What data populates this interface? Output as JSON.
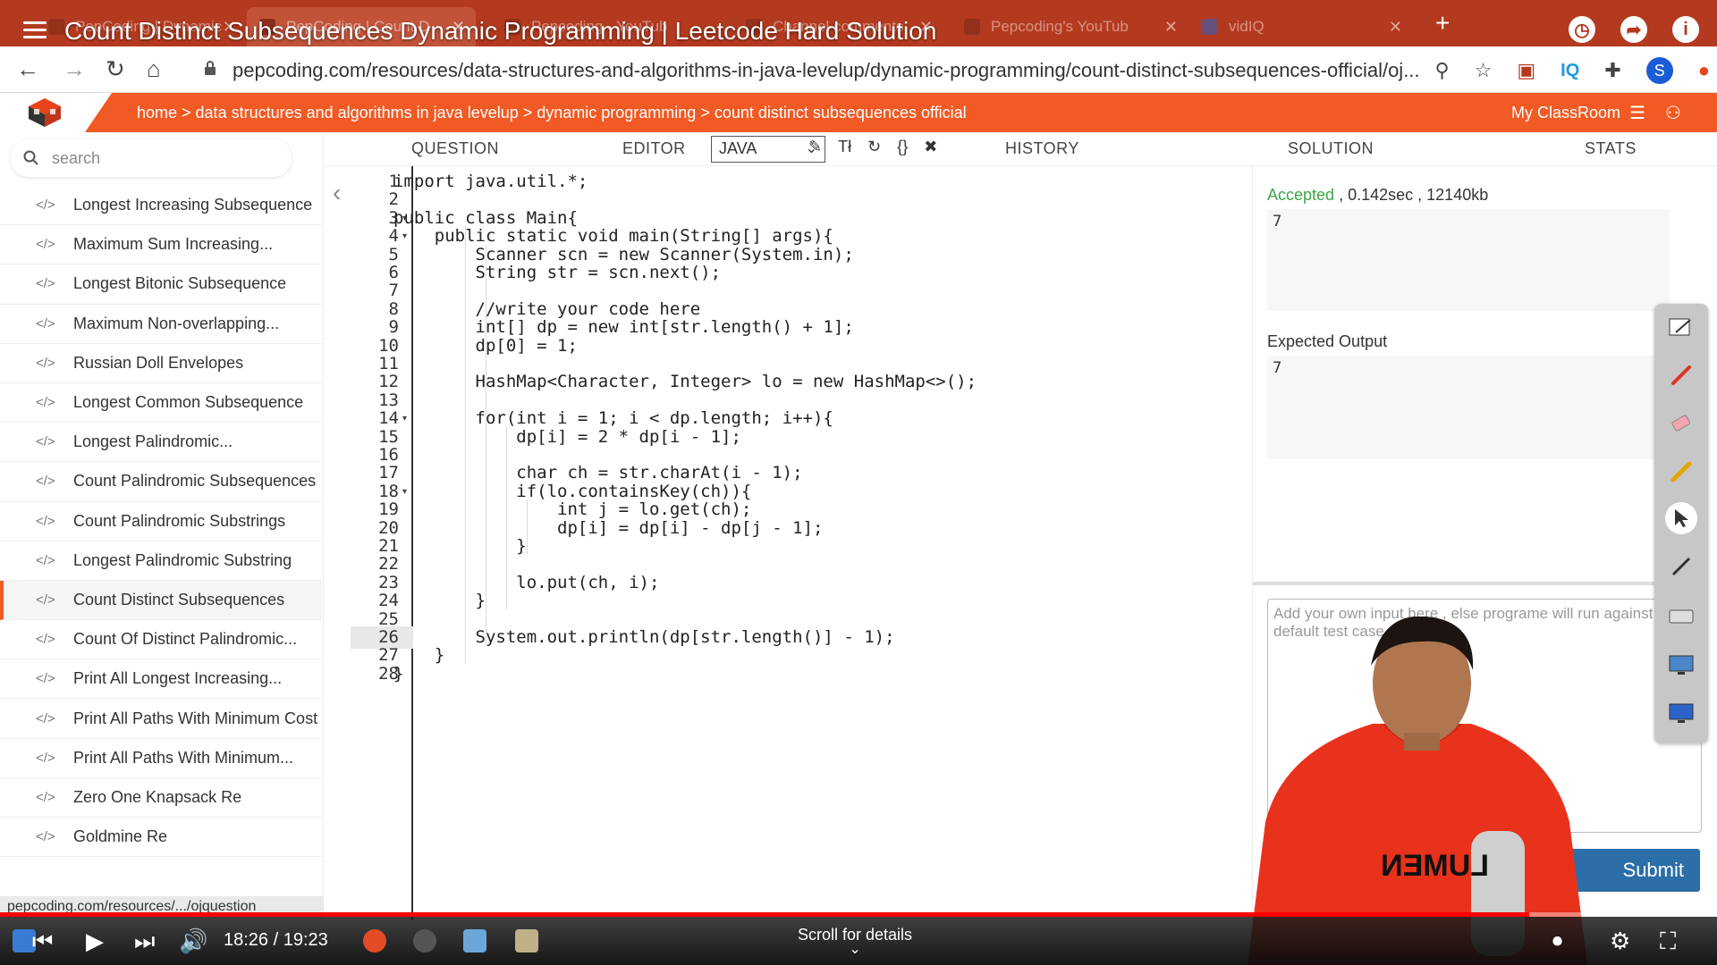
{
  "browser": {
    "tabs": [
      {
        "label": "PepCoding | Dynamic"
      },
      {
        "label": "PepCoding | Count D"
      },
      {
        "label": "Pepcoding - YouTub"
      },
      {
        "label": "Channel comments"
      },
      {
        "label": "Pepcoding's YouTub"
      },
      {
        "label": "vidIQ"
      }
    ],
    "url": "pepcoding.com/resources/data-structures-and-algorithms-in-java-levelup/dynamic-programming/count-distinct-subsequences-official/oj..."
  },
  "video": {
    "title": "Count Distinct Subsequences Dynamic Programming | Leetcode Hard Solution",
    "time_current": "18:26",
    "time_separator": "/",
    "time_total": "19:23",
    "scroll_hint": "Scroll for details",
    "progress": 0.95
  },
  "site": {
    "breadcrumb": "home > data structures and algorithms in java levelup > dynamic programming > count distinct subsequences official",
    "my_classroom": "My ClassRoom",
    "accent_color": "#f15a24"
  },
  "sidebar": {
    "search_placeholder": "search",
    "items": [
      {
        "label": "Longest Increasing Subsequence"
      },
      {
        "label": "Maximum Sum Increasing..."
      },
      {
        "label": "Longest Bitonic Subsequence"
      },
      {
        "label": "Maximum Non-overlapping..."
      },
      {
        "label": "Russian Doll Envelopes"
      },
      {
        "label": "Longest Common Subsequence"
      },
      {
        "label": "Longest Palindromic..."
      },
      {
        "label": "Count Palindromic Subsequences"
      },
      {
        "label": "Count Palindromic Substrings"
      },
      {
        "label": "Longest Palindromic Substring"
      },
      {
        "label": "Count Distinct Subsequences"
      },
      {
        "label": "Count Of Distinct Palindromic..."
      },
      {
        "label": "Print All Longest Increasing..."
      },
      {
        "label": "Print All Paths With Minimum Cost"
      },
      {
        "label": "Print All Paths With Minimum..."
      },
      {
        "label": "Zero One Knapsack Re"
      },
      {
        "label": "Goldmine Re"
      }
    ],
    "status_url": "pepcoding.com/resources/.../ojquestion"
  },
  "tabs": {
    "question": "QUESTION",
    "editor": "EDITOR",
    "language": "JAVA",
    "history": "HISTORY",
    "solution": "SOLUTION",
    "stats": "STATS"
  },
  "editor": {
    "lines": [
      "import java.util.*;",
      "",
      "public class Main{",
      "    public static void main(String[] args){",
      "        Scanner scn = new Scanner(System.in);",
      "        String str = scn.next();",
      "",
      "        //write your code here",
      "        int[] dp = new int[str.length() + 1];",
      "        dp[0] = 1;",
      "",
      "        HashMap<Character, Integer> lo = new HashMap<>();",
      "",
      "        for(int i = 1; i < dp.length; i++){",
      "            dp[i] = 2 * dp[i - 1];",
      "",
      "            char ch = str.charAt(i - 1);",
      "            if(lo.containsKey(ch)){",
      "                int j = lo.get(ch);",
      "                dp[i] = dp[i] - dp[j - 1];",
      "            }",
      "",
      "            lo.put(ch, i);",
      "        }",
      "",
      "        System.out.println(dp[str.length()] - 1);",
      "    }",
      "}"
    ],
    "line_numbers": [
      "1",
      "2",
      "3",
      "4",
      "5",
      "6",
      "7",
      "8",
      "9",
      "10",
      "11",
      "12",
      "13",
      "14",
      "15",
      "16",
      "17",
      "18",
      "19",
      "20",
      "21",
      "22",
      "23",
      "24",
      "25",
      "26",
      "27",
      "28"
    ],
    "current_line": 26
  },
  "result": {
    "status": "Accepted",
    "time": ", 0.142sec",
    "memory": ", 12140kb",
    "output": "7",
    "expected_label": "Expected Output",
    "expected": "7",
    "input_placeholder": "Add your own input here , else programe will run against default test case",
    "submit": "Submit"
  }
}
